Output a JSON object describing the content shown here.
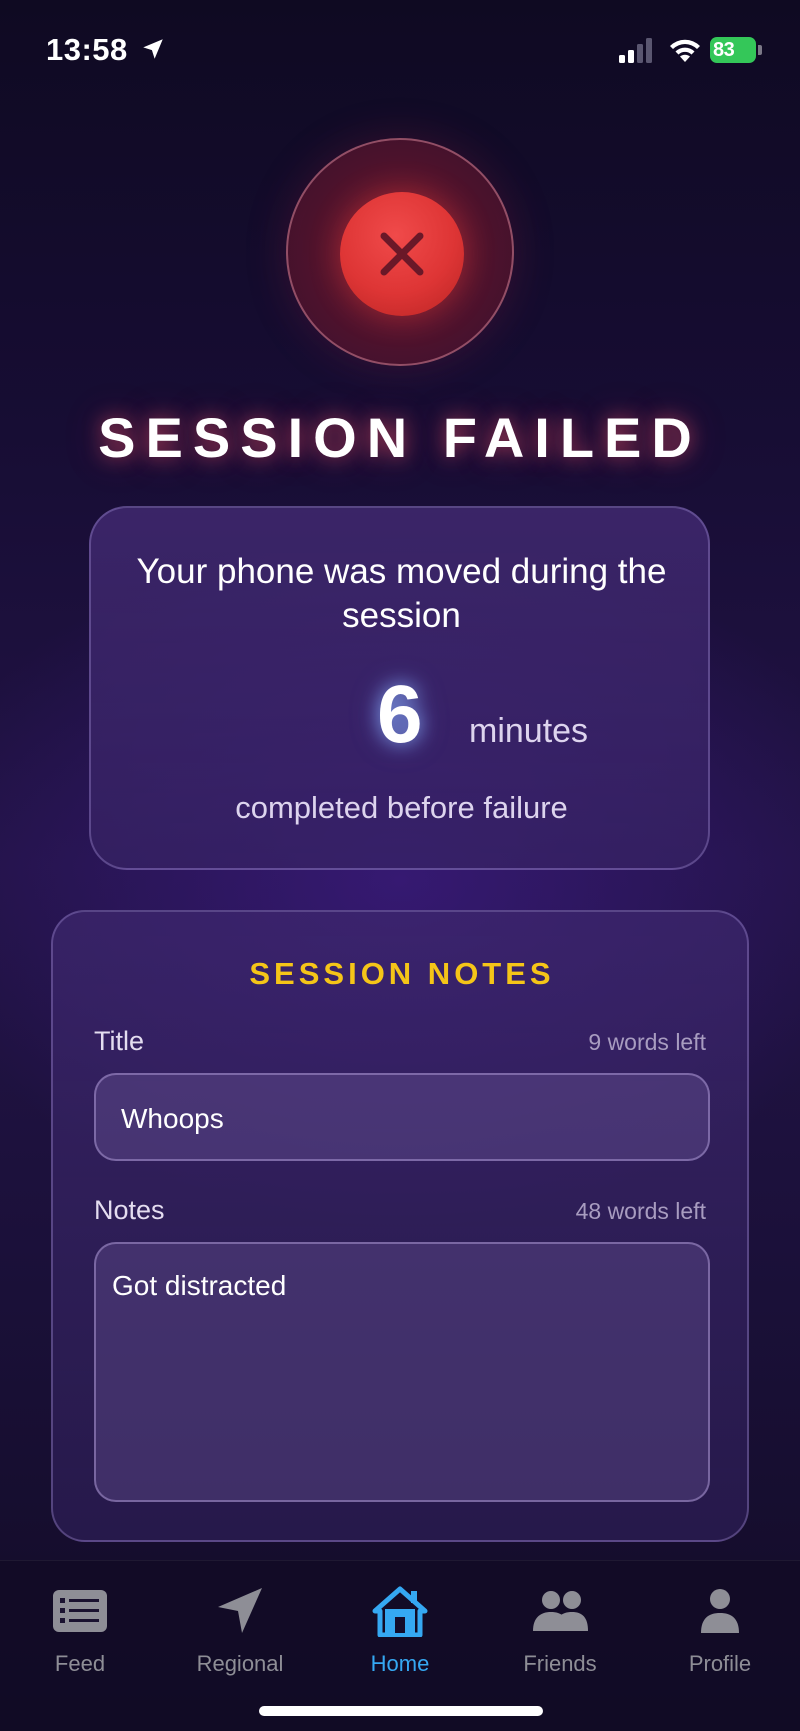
{
  "status_bar": {
    "time": "13:58",
    "battery": "83",
    "icons": [
      "location-arrow-icon",
      "cellular-signal-icon",
      "wifi-icon",
      "battery-charging-icon"
    ]
  },
  "result": {
    "icon": "close-icon",
    "headline": "SESSION FAILED",
    "message": "Your phone was moved during the session",
    "minutes_value": "6",
    "minutes_unit": "minutes",
    "caption": "completed before failure"
  },
  "notes": {
    "heading": "SESSION NOTES",
    "title_label": "Title",
    "title_words_left": "9 words left",
    "title_value": "Whoops",
    "notes_label": "Notes",
    "notes_words_left": "48 words left",
    "notes_value": "Got distracted"
  },
  "tabs": [
    {
      "label": "Feed",
      "icon": "list-icon",
      "active": false
    },
    {
      "label": "Regional",
      "icon": "navigation-arrow-icon",
      "active": false
    },
    {
      "label": "Home",
      "icon": "home-icon",
      "active": true
    },
    {
      "label": "Friends",
      "icon": "friends-icon",
      "active": false
    },
    {
      "label": "Profile",
      "icon": "person-icon",
      "active": false
    }
  ],
  "colors": {
    "accent_blue": "#35a8f2",
    "heading_yellow": "#f5c518",
    "fail_red": "#de3535",
    "battery_green": "#34c759"
  }
}
